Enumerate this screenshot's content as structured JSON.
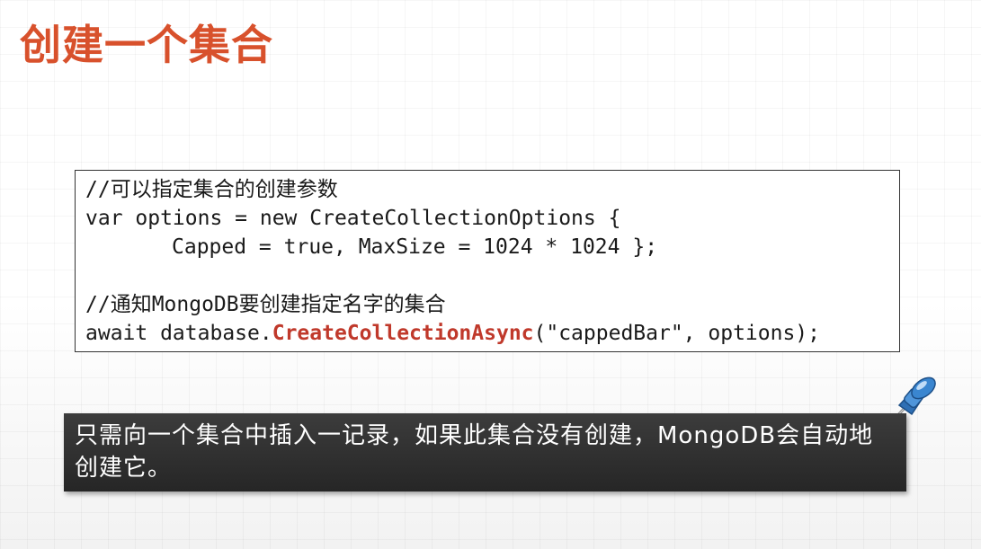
{
  "slide": {
    "title": "创建一个集合"
  },
  "code": {
    "line1": "//可以指定集合的创建参数",
    "line2": "var options = new CreateCollectionOptions {",
    "line3": "Capped = true, MaxSize = 1024 * 1024 };",
    "line4": "",
    "line5": "//通知MongoDB要创建指定名字的集合",
    "line6_prefix": "await database.",
    "line6_method": "CreateCollectionAsync",
    "line6_suffix": "(\"cappedBar\", options);"
  },
  "callout": {
    "text": "只需向一个集合中插入一记录，如果此集合没有创建，MongoDB会自动地创建它。",
    "icon": "pushpin-icon"
  },
  "colors": {
    "title": "#d8512c",
    "method_highlight": "#c0392b",
    "callout_bg": "#2f2f2f",
    "pin_head": "#3a86d0"
  }
}
